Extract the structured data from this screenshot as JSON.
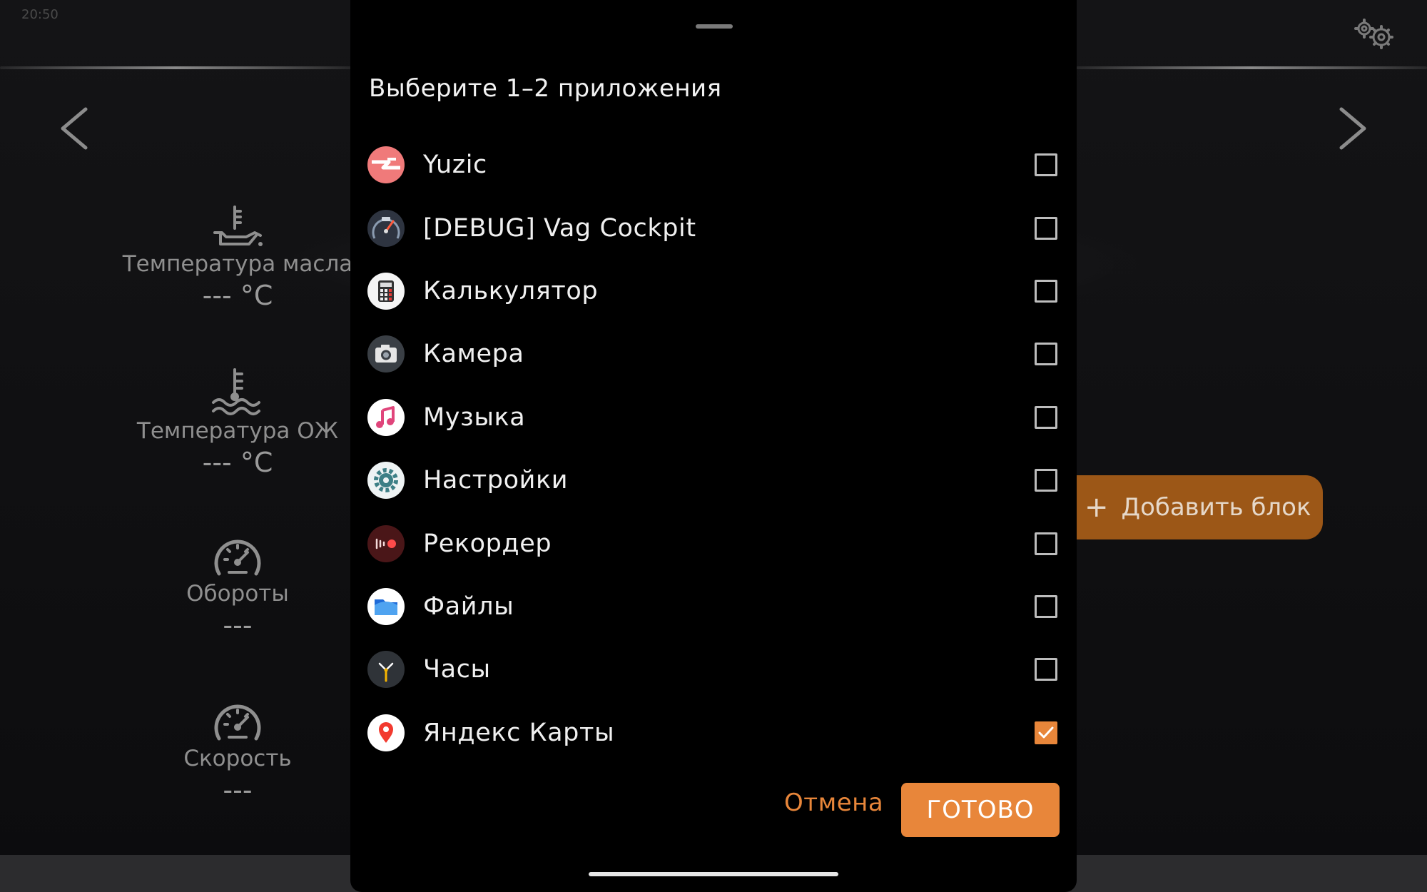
{
  "status_bar": {
    "text": "20:50"
  },
  "background": {
    "gauges": [
      {
        "label": "Температура масла",
        "value": "--- °C",
        "icon": "oil-temperature-icon"
      },
      {
        "label": "Температура ОЖ",
        "value": "--- °C",
        "icon": "coolant-temperature-icon"
      },
      {
        "label": "Обороты",
        "value": "---",
        "icon": "tachometer-icon"
      },
      {
        "label": "Скорость",
        "value": "---",
        "icon": "speedometer-icon"
      }
    ],
    "add_block_label": "Добавить блок",
    "add_block_symbol": "+"
  },
  "dialog": {
    "title": "Выберите 1–2 приложения",
    "apps": [
      {
        "name": "Yuzic",
        "icon": "yuzic-icon",
        "checked": false
      },
      {
        "name": "[DEBUG] Vag Cockpit",
        "icon": "vag-cockpit-icon",
        "checked": false
      },
      {
        "name": "Калькулятор",
        "icon": "calculator-icon",
        "checked": false
      },
      {
        "name": "Камера",
        "icon": "camera-icon",
        "checked": false
      },
      {
        "name": "Музыка",
        "icon": "music-icon",
        "checked": false
      },
      {
        "name": "Настройки",
        "icon": "settings-icon",
        "checked": false
      },
      {
        "name": "Рекордер",
        "icon": "recorder-icon",
        "checked": false
      },
      {
        "name": "Файлы",
        "icon": "files-icon",
        "checked": false
      },
      {
        "name": "Часы",
        "icon": "clock-icon",
        "checked": false
      },
      {
        "name": "Яндекс Карты",
        "icon": "yandex-maps-icon",
        "checked": true
      }
    ],
    "cancel_label": "Отмена",
    "done_label": "ГОТОВО"
  },
  "colors": {
    "accent": "#e8863a",
    "add_block_bg": "#9c5717"
  }
}
